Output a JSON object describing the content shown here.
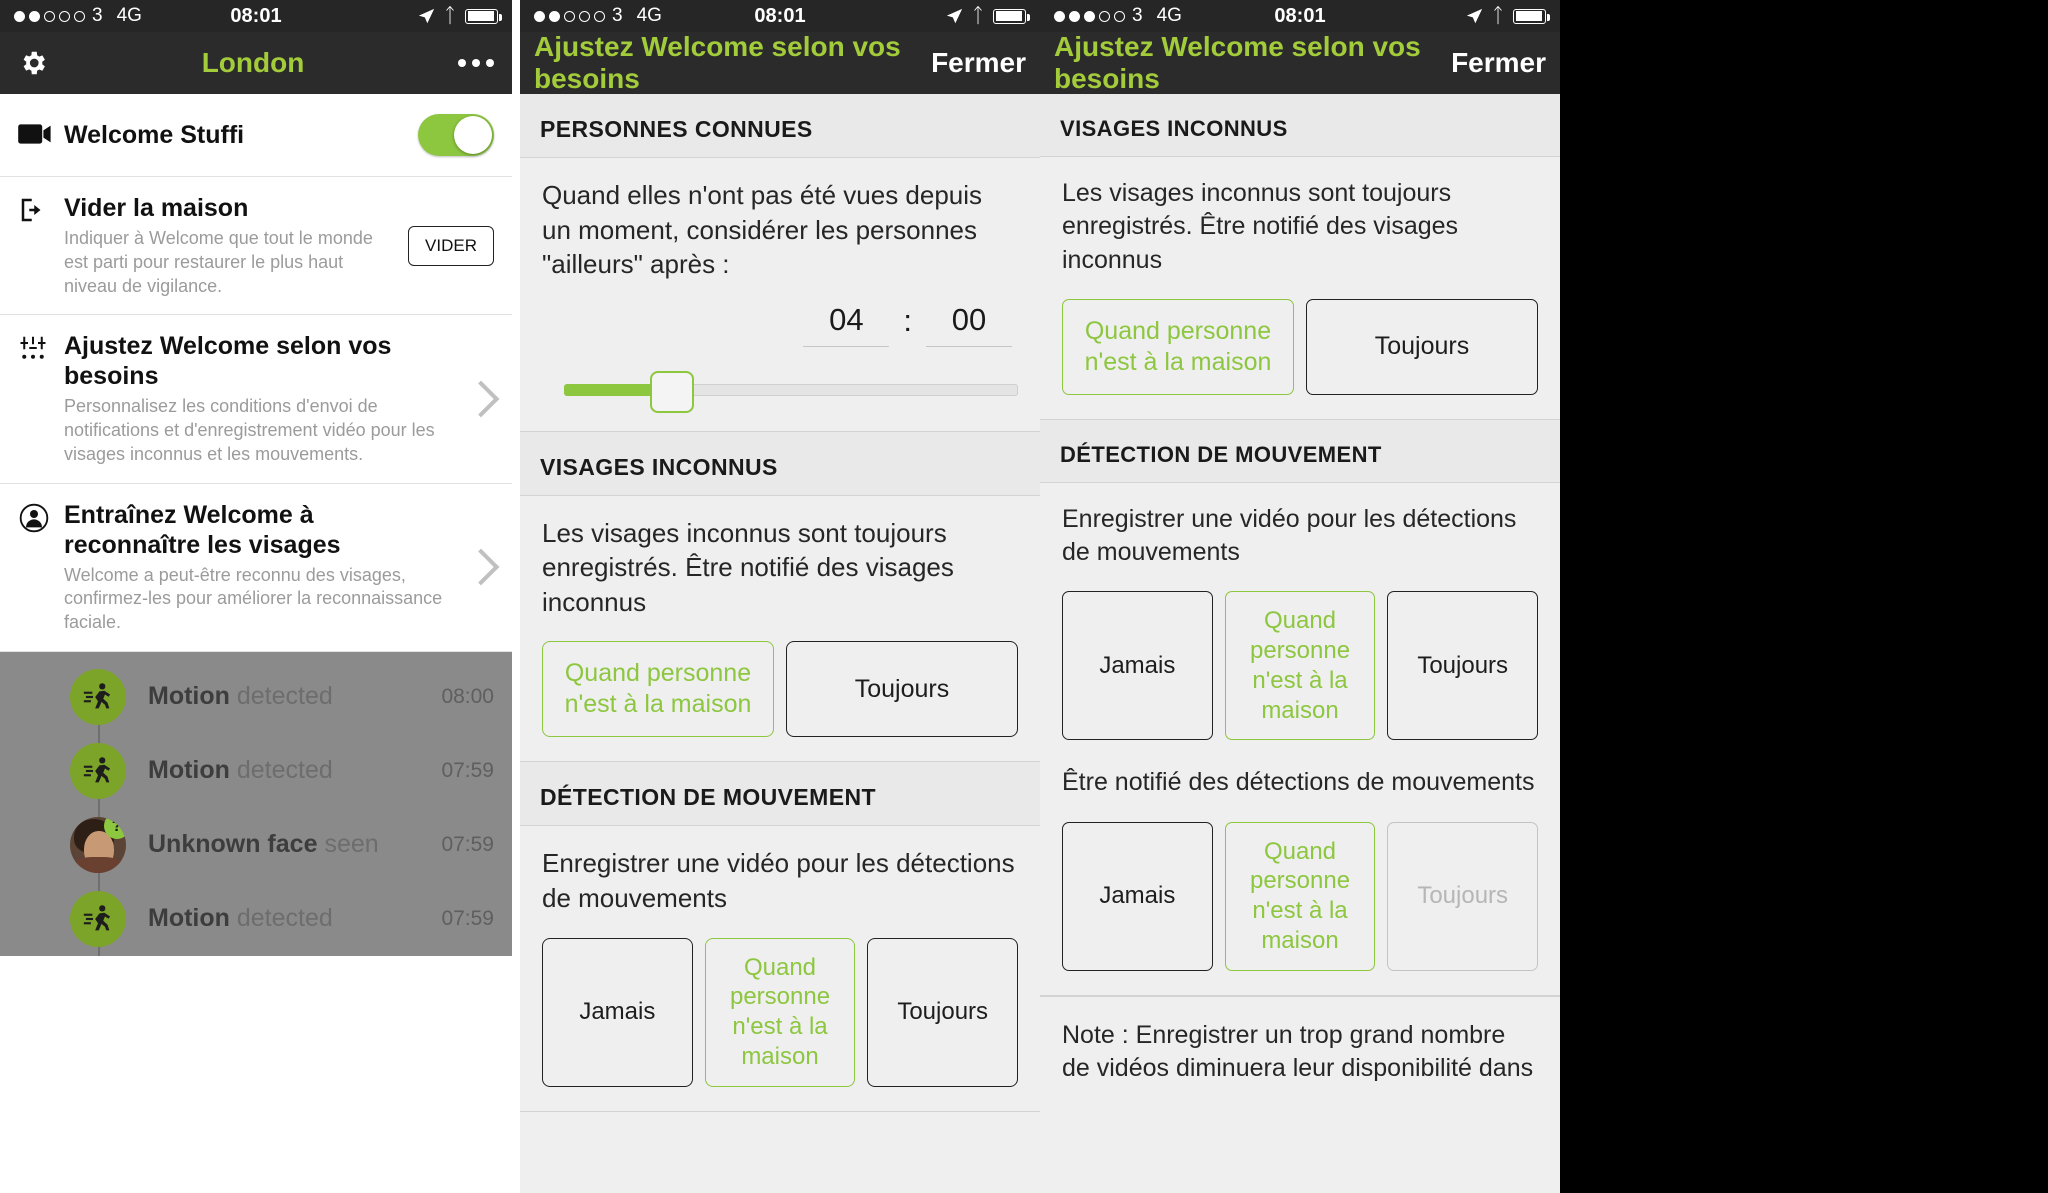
{
  "status_bar": {
    "signal_filled_1": 2,
    "signal_filled_3": 3,
    "signal_total": 5,
    "carrier_number": "3",
    "network": "4G",
    "time": "08:01"
  },
  "panel1": {
    "nav": {
      "title": "London",
      "gear_icon": "gear-icon",
      "more_icon": "ellipsis-icon"
    },
    "rows": [
      {
        "icon": "video-camera-icon",
        "title": "Welcome Stuffi",
        "sub": "",
        "control": "toggle",
        "toggle_on": true
      },
      {
        "icon": "exit-door-icon",
        "title": "Vider la maison",
        "sub": "Indiquer à Welcome que tout le monde est parti pour restaurer le plus haut niveau de vigilance.",
        "control": "button",
        "button_label": "VIDER"
      },
      {
        "icon": "sliders-icon",
        "title": "Ajustez Welcome selon vos besoins",
        "sub": "Personnalisez les conditions d'envoi de notifications et d'enregistrement vidéo pour les visages inconnus et les mouvements.",
        "control": "chevron"
      },
      {
        "icon": "person-circle-icon",
        "title": "Entraînez Welcome à reconnaître les visages",
        "sub": "Welcome a peut-être reconnu des visages, confirmez-les pour améliorer la reconnaissance faciale.",
        "control": "chevron"
      }
    ],
    "timeline": [
      {
        "icon": "running-person-icon",
        "title": "Motion",
        "suffix": "detected",
        "time": "08:00"
      },
      {
        "icon": "running-person-icon",
        "title": "Motion",
        "suffix": "detected",
        "time": "07:59"
      },
      {
        "icon": "unknown-face-icon",
        "title": "Unknown face",
        "suffix": "seen",
        "time": "07:59",
        "badge": "?"
      },
      {
        "icon": "running-person-icon",
        "title": "Motion",
        "suffix": "detected",
        "time": "07:59"
      }
    ]
  },
  "panel2": {
    "nav": {
      "title": "Ajustez Welcome selon vos besoins",
      "close": "Fermer"
    },
    "section_known": {
      "header": "PERSONNES CONNUES",
      "text": "Quand elles n'ont pas été vues depuis un moment, considérer les personnes \"ailleurs\" après :",
      "hours": "04",
      "colon": ":",
      "minutes": "00"
    },
    "section_unknown": {
      "header": "VISAGES INCONNUS",
      "text": "Les visages inconnus sont toujours enregistrés. Être notifié des visages inconnus",
      "options": [
        {
          "label": "Quand personne n'est à la maison",
          "state": "selected"
        },
        {
          "label": "Toujours",
          "state": "normal"
        }
      ]
    },
    "section_motion": {
      "header": "DÉTECTION DE MOUVEMENT",
      "text": "Enregistrer une vidéo pour les détections de mouvements",
      "options": [
        {
          "label": "Jamais",
          "state": "normal"
        },
        {
          "label": "Quand personne n'est à la maison",
          "state": "selected"
        },
        {
          "label": "Toujours",
          "state": "normal"
        }
      ]
    }
  },
  "panel3": {
    "nav": {
      "title": "Ajustez Welcome selon vos besoins",
      "close": "Fermer"
    },
    "section_unknown": {
      "header": "VISAGES INCONNUS",
      "text": "Les visages inconnus sont toujours enregistrés. Être notifié des visages inconnus",
      "options": [
        {
          "label": "Quand personne n'est à la maison",
          "state": "selected"
        },
        {
          "label": "Toujours",
          "state": "normal"
        }
      ]
    },
    "section_motion": {
      "header": "DÉTECTION DE MOUVEMENT",
      "text_record": "Enregistrer une vidéo pour les détections de mouvements",
      "options_record": [
        {
          "label": "Jamais",
          "state": "normal"
        },
        {
          "label": "Quand personne n'est à la maison",
          "state": "selected"
        },
        {
          "label": "Toujours",
          "state": "normal"
        }
      ],
      "text_notify": "Être notifié des détections de mouvements",
      "options_notify": [
        {
          "label": "Jamais",
          "state": "normal"
        },
        {
          "label": "Quand personne n'est à la maison",
          "state": "selected"
        },
        {
          "label": "Toujours",
          "state": "disabled"
        }
      ]
    },
    "note": "Note : Enregistrer un trop grand nombre de vidéos diminuera leur disponibilité dans"
  },
  "colors": {
    "accent_green": "#8dc63f",
    "nav_bg": "#2b2b2b",
    "status_bg": "#262626",
    "panel_bg": "#efefef",
    "dim_overlay": "#8a8a8a"
  }
}
